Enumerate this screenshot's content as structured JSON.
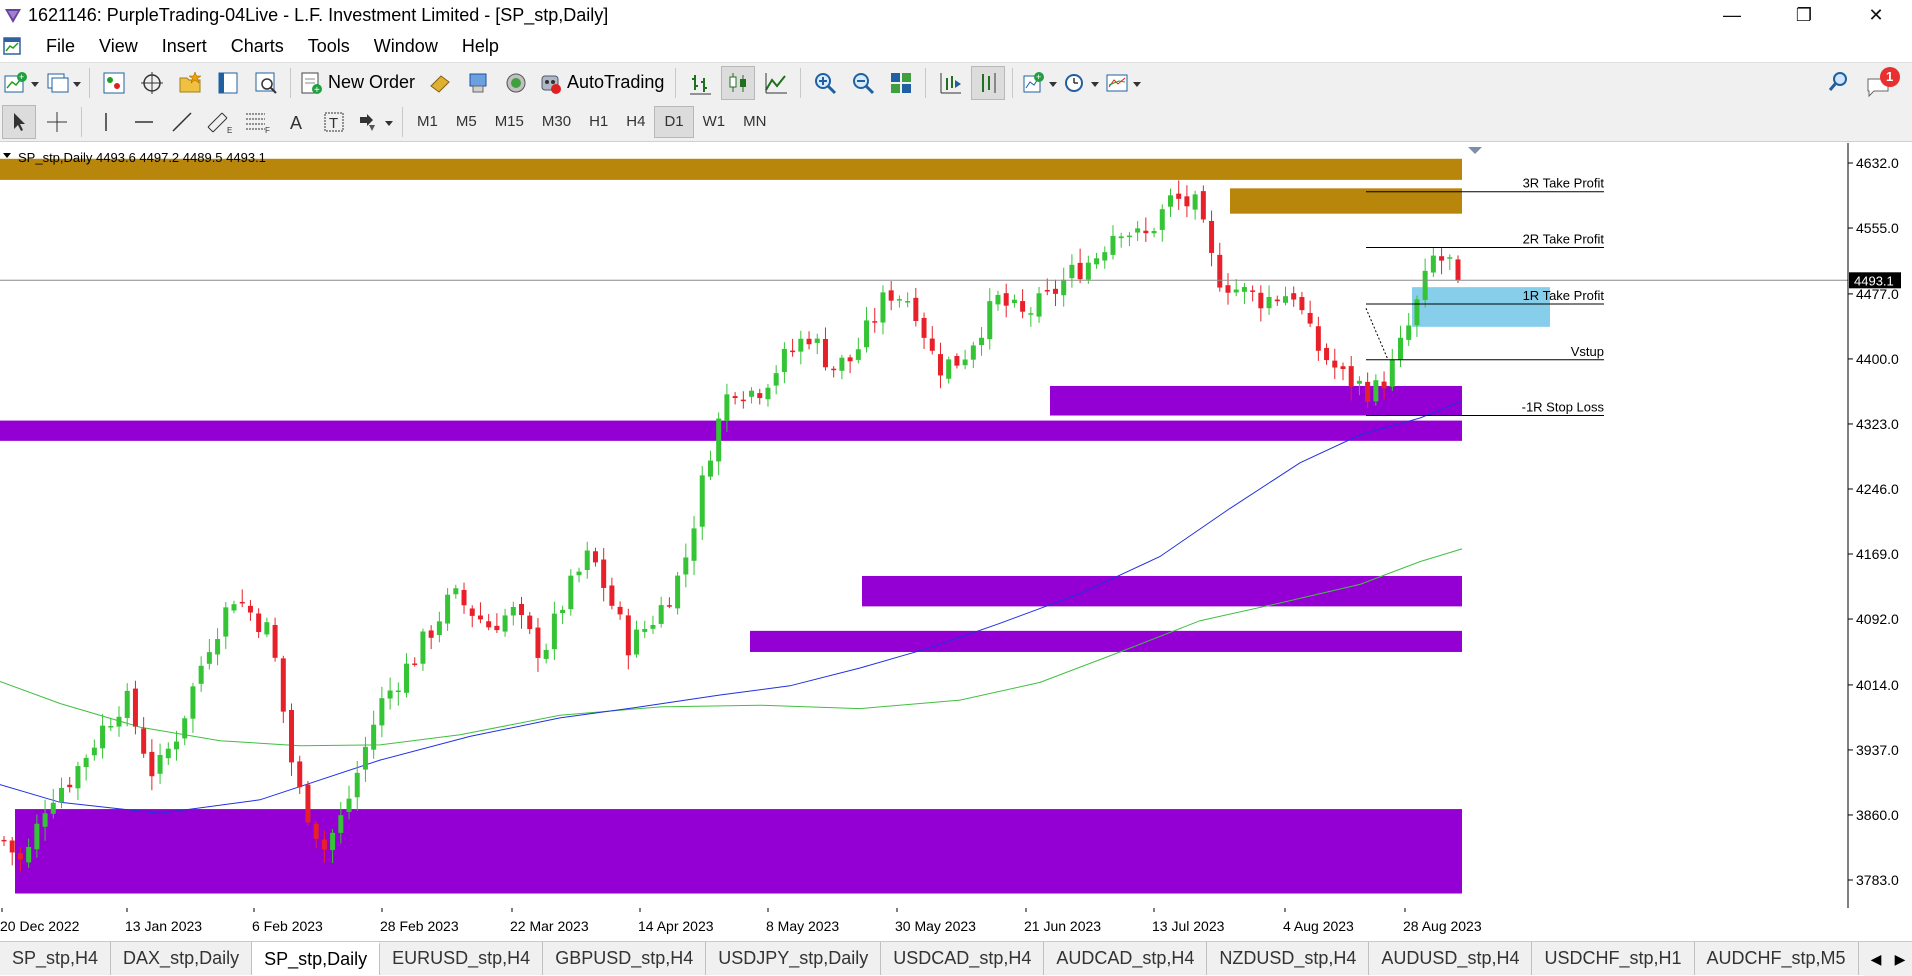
{
  "window": {
    "title": "1621146: PurpleTrading-04Live - L.F. Investment Limited - [SP_stp,Daily]",
    "minimize": "—",
    "maximize": "❐",
    "close": "✕"
  },
  "menu": [
    "File",
    "View",
    "Insert",
    "Charts",
    "Tools",
    "Window",
    "Help"
  ],
  "toolbar": {
    "new_order_label": "New Order",
    "autotrading_label": "AutoTrading",
    "notification_count": "1"
  },
  "timeframes": [
    "M1",
    "M5",
    "M15",
    "M30",
    "H1",
    "H4",
    "D1",
    "W1",
    "MN"
  ],
  "active_timeframe": "D1",
  "chart": {
    "header": "SP_stp,Daily  4493.6 4497.2 4489.5 4493.1",
    "current_price": "4493.1",
    "price_axis": [
      "4632.0",
      "4555.0",
      "4477.0",
      "4400.0",
      "4323.0",
      "4246.0",
      "4169.0",
      "4092.0",
      "4014.0",
      "3937.0",
      "3860.0",
      "3783.0"
    ],
    "date_axis": [
      "20 Dec 2022",
      "13 Jan 2023",
      "6 Feb 2023",
      "28 Feb 2023",
      "22 Mar 2023",
      "14 Apr 2023",
      "8 May 2023",
      "30 May 2023",
      "21 Jun 2023",
      "13 Jul 2023",
      "4 Aug 2023",
      "28 Aug 2023"
    ],
    "levels": [
      {
        "label": "3R Take Profit",
        "price": 4598
      },
      {
        "label": "2R Take Profit",
        "price": 4532
      },
      {
        "label": "1R Take Profit",
        "price": 4465
      },
      {
        "label": "Vstup",
        "price": 4399
      },
      {
        "label": "-1R Stop Loss",
        "price": 4333
      }
    ],
    "colors": {
      "bull": "#35c435",
      "bear": "#e8202a",
      "zone_supply": "#b8860b",
      "zone_demand": "#9400d3",
      "zone_target": "#87ceeb",
      "ma_fast": "#2030e0",
      "ma_slow": "#40c040"
    }
  },
  "tabs": [
    "SP_stp,H4",
    "DAX_stp,Daily",
    "SP_stp,Daily",
    "EURUSD_stp,H4",
    "GBPUSD_stp,H4",
    "USDJPY_stp,Daily",
    "USDCAD_stp,H4",
    "AUDCAD_stp,H4",
    "NZDUSD_stp,H4",
    "AUDUSD_stp,H4",
    "USDCHF_stp,H1",
    "AUDCHF_stp,M5"
  ],
  "active_tab": "SP_stp,Daily"
}
